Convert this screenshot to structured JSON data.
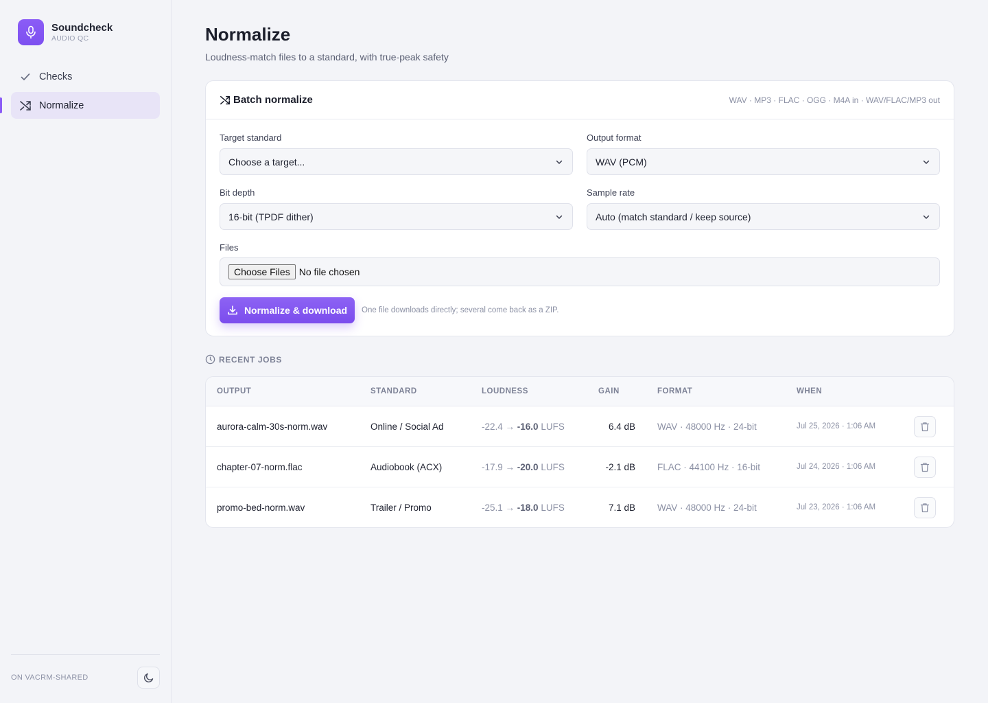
{
  "brand": {
    "name": "Soundcheck",
    "subtitle": "AUDIO QC"
  },
  "nav": {
    "items": [
      {
        "label": "Checks",
        "icon": "check-icon"
      },
      {
        "label": "Normalize",
        "icon": "shuffle-icon",
        "active": true
      }
    ]
  },
  "footer": {
    "env_label": "ON VACRM-SHARED",
    "theme_icon": "moon-icon"
  },
  "page": {
    "title": "Normalize",
    "subtitle": "Loudness-match files to a standard, with true-peak safety"
  },
  "batch": {
    "title": "Batch normalize",
    "formats": "WAV · MP3 · FLAC · OGG · M4A in · WAV/FLAC/MP3 out",
    "target_label": "Target standard",
    "target_value": "Choose a target...",
    "output_label": "Output format",
    "output_value": "WAV (PCM)",
    "bitdepth_label": "Bit depth",
    "bitdepth_value": "16-bit (TPDF dither)",
    "samplerate_label": "Sample rate",
    "samplerate_value": "Auto (match standard / keep source)",
    "files_label": "Files",
    "choose_files": "Choose Files",
    "no_file": "No file chosen",
    "submit_label": "Normalize & download",
    "hint": "One file downloads directly; several come back as a ZIP."
  },
  "recent": {
    "title": "RECENT JOBS",
    "columns": [
      "OUTPUT",
      "STANDARD",
      "LOUDNESS",
      "GAIN",
      "FORMAT",
      "WHEN"
    ],
    "rows": [
      {
        "output": "aurora-calm-30s-norm.wav",
        "standard": "Online / Social Ad",
        "loud_from": "-22.4 →",
        "loud_to": "-16.0",
        "loud_unit": "LUFS",
        "gain": "6.4 dB",
        "format": "WAV · 48000 Hz · 24-bit",
        "when": "Jul 25, 2026 · 1:06 AM"
      },
      {
        "output": "chapter-07-norm.flac",
        "standard": "Audiobook (ACX)",
        "loud_from": "-17.9 →",
        "loud_to": "-20.0",
        "loud_unit": "LUFS",
        "gain": "-2.1 dB",
        "format": "FLAC · 44100 Hz · 16-bit",
        "when": "Jul 24, 2026 · 1:06 AM"
      },
      {
        "output": "promo-bed-norm.wav",
        "standard": "Trailer / Promo",
        "loud_from": "-25.1 →",
        "loud_to": "-18.0",
        "loud_unit": "LUFS",
        "gain": "7.1 dB",
        "format": "WAV · 48000 Hz · 24-bit",
        "when": "Jul 23, 2026 · 1:06 AM"
      }
    ]
  },
  "colors": {
    "accent": "#8b5cf6",
    "accent_dark": "#7b4ced",
    "background": "#f3f4f8"
  }
}
